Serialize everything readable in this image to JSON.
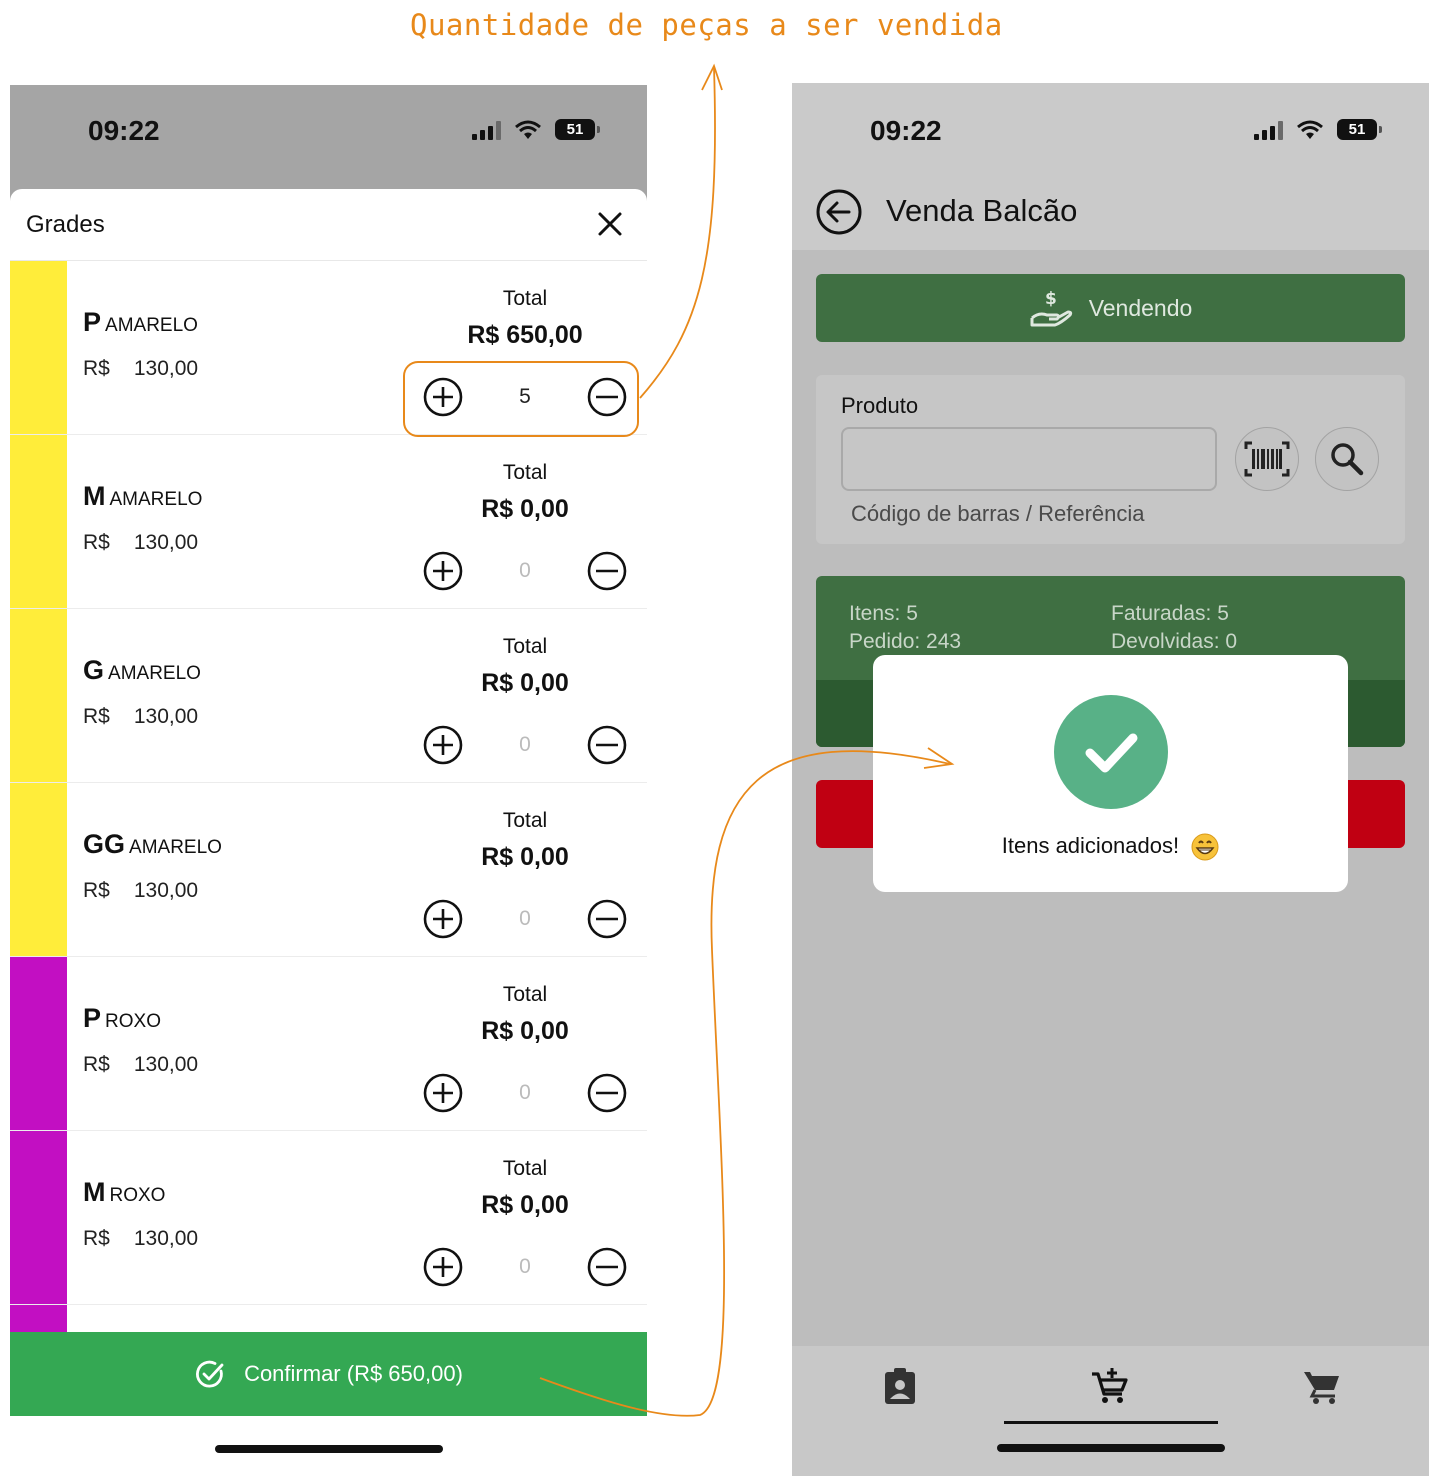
{
  "annotation": {
    "title": "Quantidade de peças a ser vendida"
  },
  "left_phone": {
    "status": {
      "time": "09:22",
      "battery": "51"
    },
    "sheet": {
      "title": "Grades",
      "currency": "R$",
      "total_label": "Total",
      "rows": [
        {
          "size": "P",
          "color": "AMARELO",
          "swatch": "#ffed3a",
          "price": "130,00",
          "total": "R$ 650,00",
          "qty": "5"
        },
        {
          "size": "M",
          "color": "AMARELO",
          "swatch": "#ffed3a",
          "price": "130,00",
          "total": "R$ 0,00",
          "qty": "0"
        },
        {
          "size": "G",
          "color": "AMARELO",
          "swatch": "#ffed3a",
          "price": "130,00",
          "total": "R$ 0,00",
          "qty": "0"
        },
        {
          "size": "GG",
          "color": "AMARELO",
          "swatch": "#ffed3a",
          "price": "130,00",
          "total": "R$ 0,00",
          "qty": "0"
        },
        {
          "size": "P",
          "color": "ROXO",
          "swatch": "#c20fc2",
          "price": "130,00",
          "total": "R$ 0,00",
          "qty": "0"
        },
        {
          "size": "M",
          "color": "ROXO",
          "swatch": "#c20fc2",
          "price": "130,00",
          "total": "R$ 0,00",
          "qty": "0"
        }
      ]
    },
    "confirm_label": "Confirmar (R$ 650,00)"
  },
  "right_phone": {
    "status": {
      "time": "09:22",
      "battery": "51"
    },
    "title": "Venda Balcão",
    "vendendo_label": "Vendendo",
    "produto": {
      "label": "Produto",
      "hint": "Código de barras / Referência",
      "value": ""
    },
    "stats": {
      "itens": "Itens: 5",
      "pedido": "Pedido: 243",
      "faturadas": "Faturadas: 5",
      "devolvidas": "Devolvidas: 0"
    },
    "modal": {
      "message": "Itens adicionados!"
    }
  },
  "colors": {
    "accent_orange": "#e8891a",
    "confirm_green": "#34a853",
    "dark_green": "#3f6f42",
    "success_green": "#58b187",
    "red": "#c00012"
  }
}
